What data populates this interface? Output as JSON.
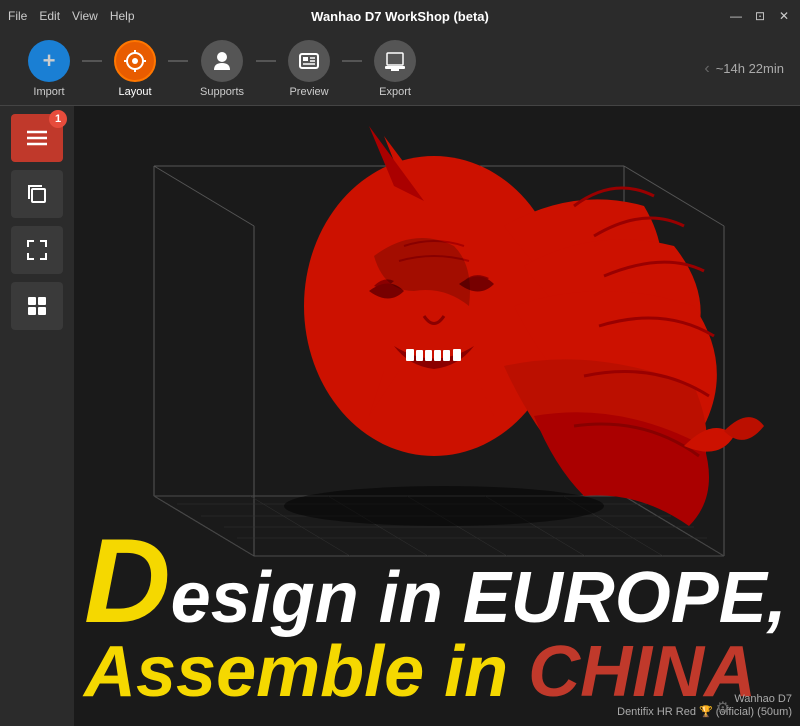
{
  "titleBar": {
    "menuItems": [
      "File",
      "Edit",
      "View",
      "Help"
    ],
    "title": "Wanhao D7 WorkShop (beta)",
    "windowControls": {
      "minimize": "—",
      "maximize": "⊡",
      "close": "✕"
    }
  },
  "toolbar": {
    "items": [
      {
        "id": "import",
        "label": "Import",
        "icon": "+",
        "style": "blue"
      },
      {
        "id": "layout",
        "label": "Layout",
        "icon": "⊞",
        "style": "active-orange"
      },
      {
        "id": "supports",
        "label": "Supports",
        "icon": "👤",
        "style": "gray"
      },
      {
        "id": "preview",
        "label": "Preview",
        "icon": "⧉",
        "style": "gray"
      },
      {
        "id": "export",
        "label": "Export",
        "icon": "🖨",
        "style": "gray"
      }
    ],
    "timeEstimate": "~14h 22min"
  },
  "sidebar": {
    "buttons": [
      {
        "id": "layers",
        "icon": "☰",
        "badge": "1",
        "style": "red"
      },
      {
        "id": "copy",
        "icon": "⧉",
        "badge": null,
        "style": "gray"
      },
      {
        "id": "expand",
        "icon": "⤢",
        "badge": null,
        "style": "gray"
      },
      {
        "id": "grid",
        "icon": "⊞",
        "badge": null,
        "style": "gray"
      }
    ]
  },
  "viewport": {
    "modelColor": "#cc0000",
    "gridColor": "#333333"
  },
  "promoText": {
    "line1BigLetter": "D",
    "line1Rest": "esign in EUROPE,",
    "line2": "Assemble in ",
    "line2China": "CHINA"
  },
  "bottomInfo": {
    "line1": "Wanhao D7",
    "line2": "Dentifix HR Red 🏆 (official) (50um)"
  },
  "cornerIcon": "⚙"
}
